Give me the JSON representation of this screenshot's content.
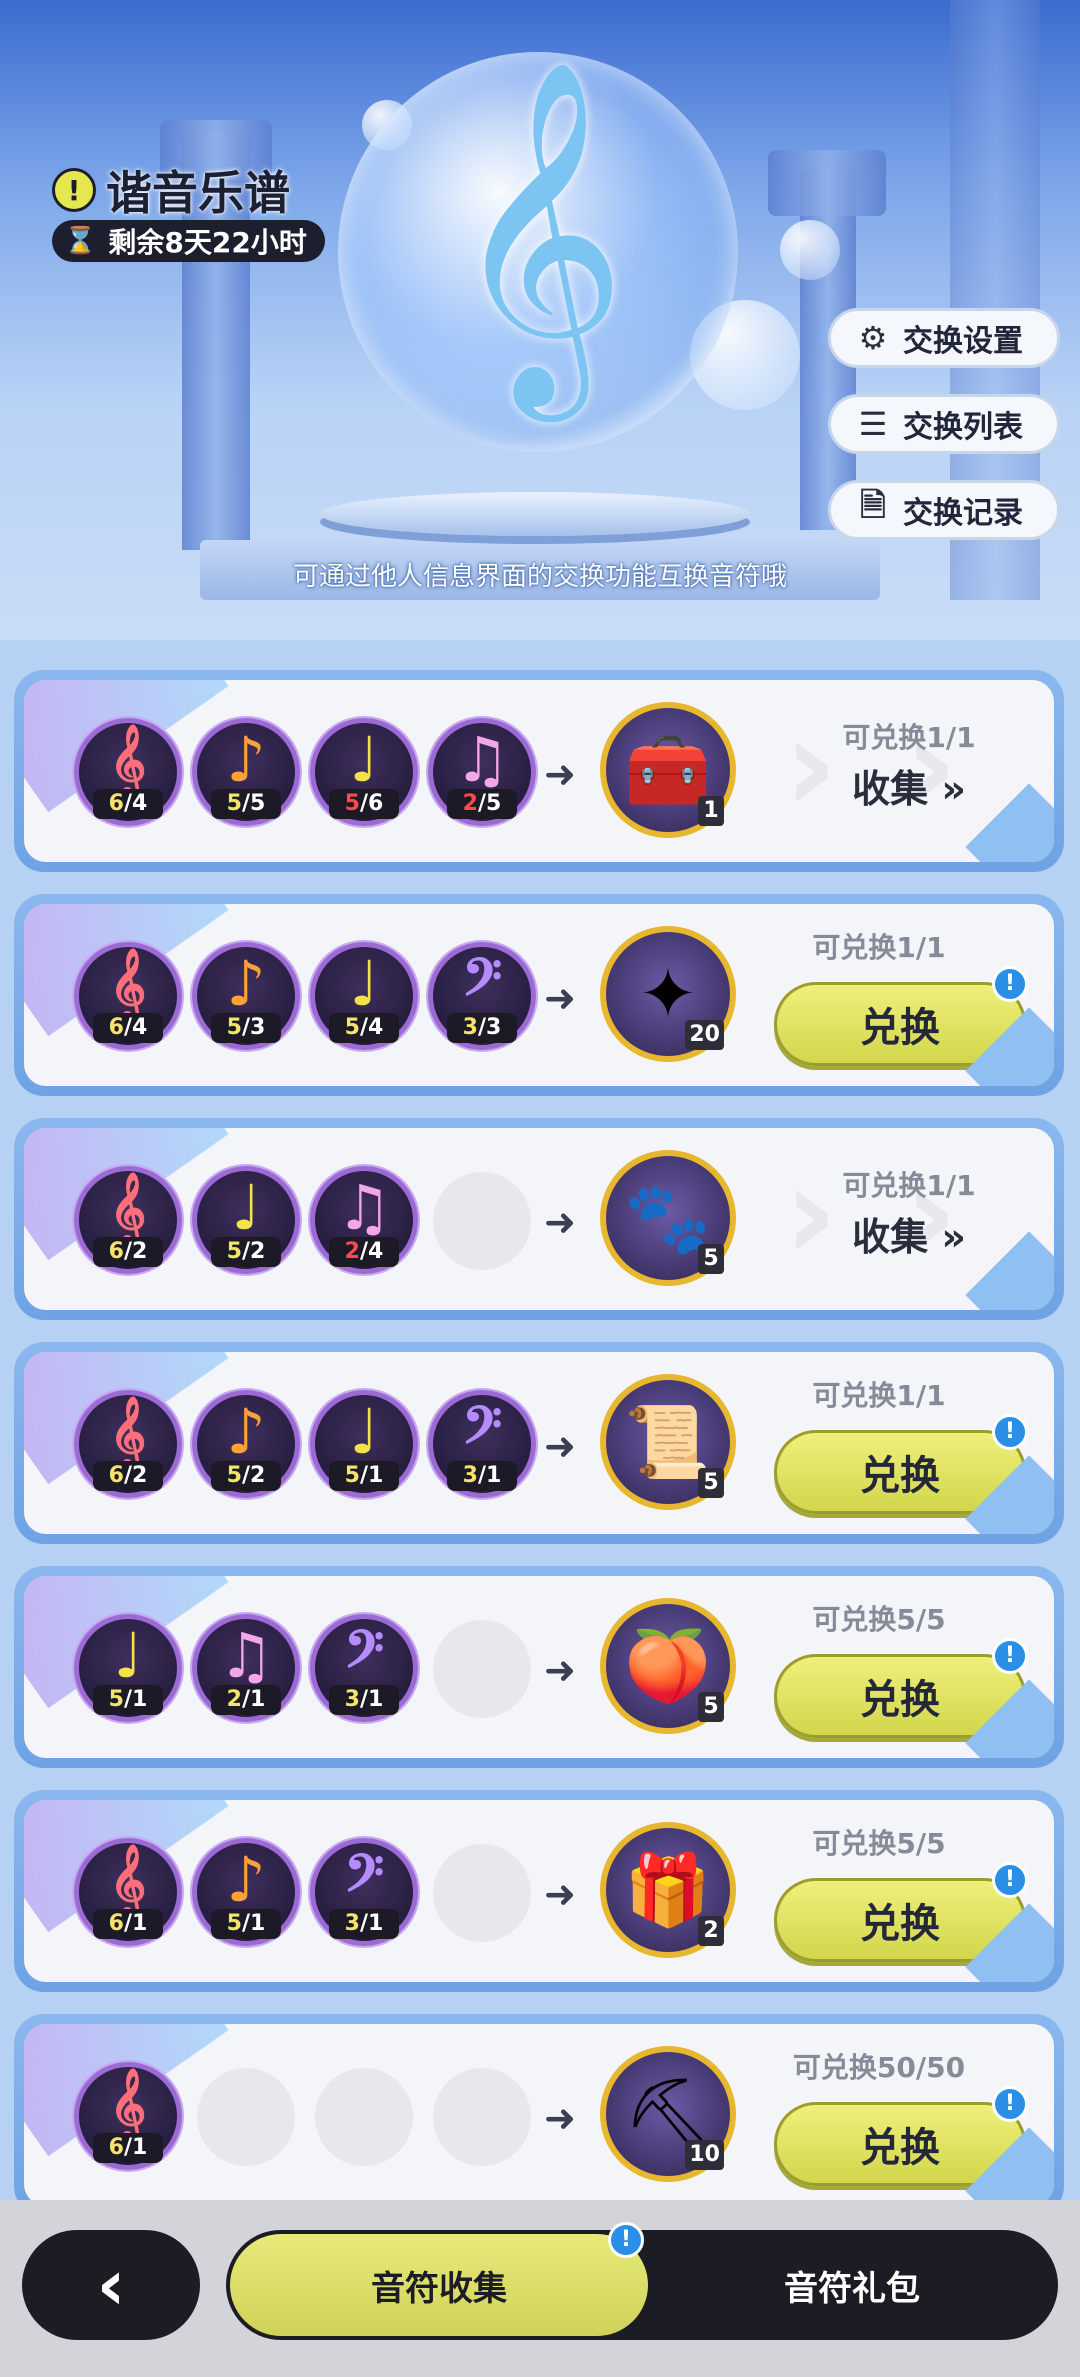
{
  "header": {
    "title": "谐音乐谱",
    "timer": "剩余8天22小时",
    "hint": "可通过他人信息界面的交换功能互换音符哦",
    "buttons": {
      "settings": "交换设置",
      "list": "交换列表",
      "records": "交换记录"
    }
  },
  "rows": [
    {
      "notes": [
        {
          "glyph": "𝄞",
          "color": "#ff6f7a",
          "have": "6",
          "need": "4",
          "low": false
        },
        {
          "glyph": "♪",
          "color": "#ffa03a",
          "have": "5",
          "need": "5",
          "low": false
        },
        {
          "glyph": "♩",
          "color": "#f2e34d",
          "have": "5",
          "need": "6",
          "low": true
        },
        {
          "glyph": "♫",
          "color": "#f4a7e8",
          "have": "2",
          "need": "5",
          "low": true
        }
      ],
      "reward": {
        "icon": "treasure-chest",
        "qty": "1"
      },
      "available": "可兑换1/1",
      "action": "collect",
      "collect_label": "收集 »"
    },
    {
      "notes": [
        {
          "glyph": "𝄞",
          "color": "#ff6f7a",
          "have": "6",
          "need": "4",
          "low": false
        },
        {
          "glyph": "♪",
          "color": "#ffa03a",
          "have": "5",
          "need": "3",
          "low": false
        },
        {
          "glyph": "♩",
          "color": "#f2e34d",
          "have": "5",
          "need": "4",
          "low": false
        },
        {
          "glyph": "𝄢",
          "color": "#b58cff",
          "have": "3",
          "need": "3",
          "low": false
        }
      ],
      "reward": {
        "icon": "crystal-star",
        "qty": "20"
      },
      "available": "可兑换1/1",
      "action": "redeem",
      "redeem_label": "兑换"
    },
    {
      "notes": [
        {
          "glyph": "𝄞",
          "color": "#ff6f7a",
          "have": "6",
          "need": "2",
          "low": false
        },
        {
          "glyph": "♩",
          "color": "#f2e34d",
          "have": "5",
          "need": "2",
          "low": false
        },
        {
          "glyph": "♫",
          "color": "#f4a7e8",
          "have": "2",
          "need": "4",
          "low": true
        }
      ],
      "reward": {
        "icon": "paw-charm",
        "qty": "5"
      },
      "available": "可兑换1/1",
      "action": "collect",
      "collect_label": "收集 »"
    },
    {
      "notes": [
        {
          "glyph": "𝄞",
          "color": "#ff6f7a",
          "have": "6",
          "need": "2",
          "low": false
        },
        {
          "glyph": "♪",
          "color": "#ffa03a",
          "have": "5",
          "need": "2",
          "low": false
        },
        {
          "glyph": "♩",
          "color": "#f2e34d",
          "have": "5",
          "need": "1",
          "low": false
        },
        {
          "glyph": "𝄢",
          "color": "#b58cff",
          "have": "3",
          "need": "1",
          "low": false
        }
      ],
      "reward": {
        "icon": "scroll",
        "qty": "5"
      },
      "available": "可兑换1/1",
      "action": "redeem",
      "redeem_label": "兑换"
    },
    {
      "notes": [
        {
          "glyph": "♩",
          "color": "#f2e34d",
          "have": "5",
          "need": "1",
          "low": false
        },
        {
          "glyph": "♫",
          "color": "#f4a7e8",
          "have": "2",
          "need": "1",
          "low": false
        },
        {
          "glyph": "𝄢",
          "color": "#b58cff",
          "have": "3",
          "need": "1",
          "low": false
        }
      ],
      "reward": {
        "icon": "peach-fruit",
        "qty": "5"
      },
      "available": "可兑换5/5",
      "action": "redeem",
      "redeem_label": "兑换"
    },
    {
      "notes": [
        {
          "glyph": "𝄞",
          "color": "#ff6f7a",
          "have": "6",
          "need": "1",
          "low": false
        },
        {
          "glyph": "♪",
          "color": "#ffa03a",
          "have": "5",
          "need": "1",
          "low": false
        },
        {
          "glyph": "𝄢",
          "color": "#b58cff",
          "have": "3",
          "need": "1",
          "low": false
        }
      ],
      "reward": {
        "icon": "mystery-gift-box",
        "qty": "2"
      },
      "available": "可兑换5/5",
      "action": "redeem",
      "redeem_label": "兑换"
    },
    {
      "notes": [
        {
          "glyph": "𝄞",
          "color": "#ff6f7a",
          "have": "6",
          "need": "1",
          "low": false
        }
      ],
      "reward": {
        "icon": "pickaxe",
        "qty": "10"
      },
      "available": "可兑换50/50",
      "action": "redeem",
      "redeem_label": "兑换"
    }
  ],
  "footer": {
    "back_icon": "chevron-left-icon",
    "tabs": [
      {
        "label": "音符收集",
        "active": true
      },
      {
        "label": "音符礼包",
        "active": false
      }
    ]
  },
  "icons": {
    "treasure-chest": "🧰",
    "crystal-star": "✦",
    "paw-charm": "🐾",
    "scroll": "📜",
    "peach-fruit": "🍑",
    "mystery-gift-box": "🎁",
    "pickaxe": "⛏"
  },
  "colors": {
    "accent_yellow": "#e3e66a",
    "badge_blue": "#2b8fe8",
    "dark": "#1c1c24",
    "low_count": "#ff4a4a"
  }
}
